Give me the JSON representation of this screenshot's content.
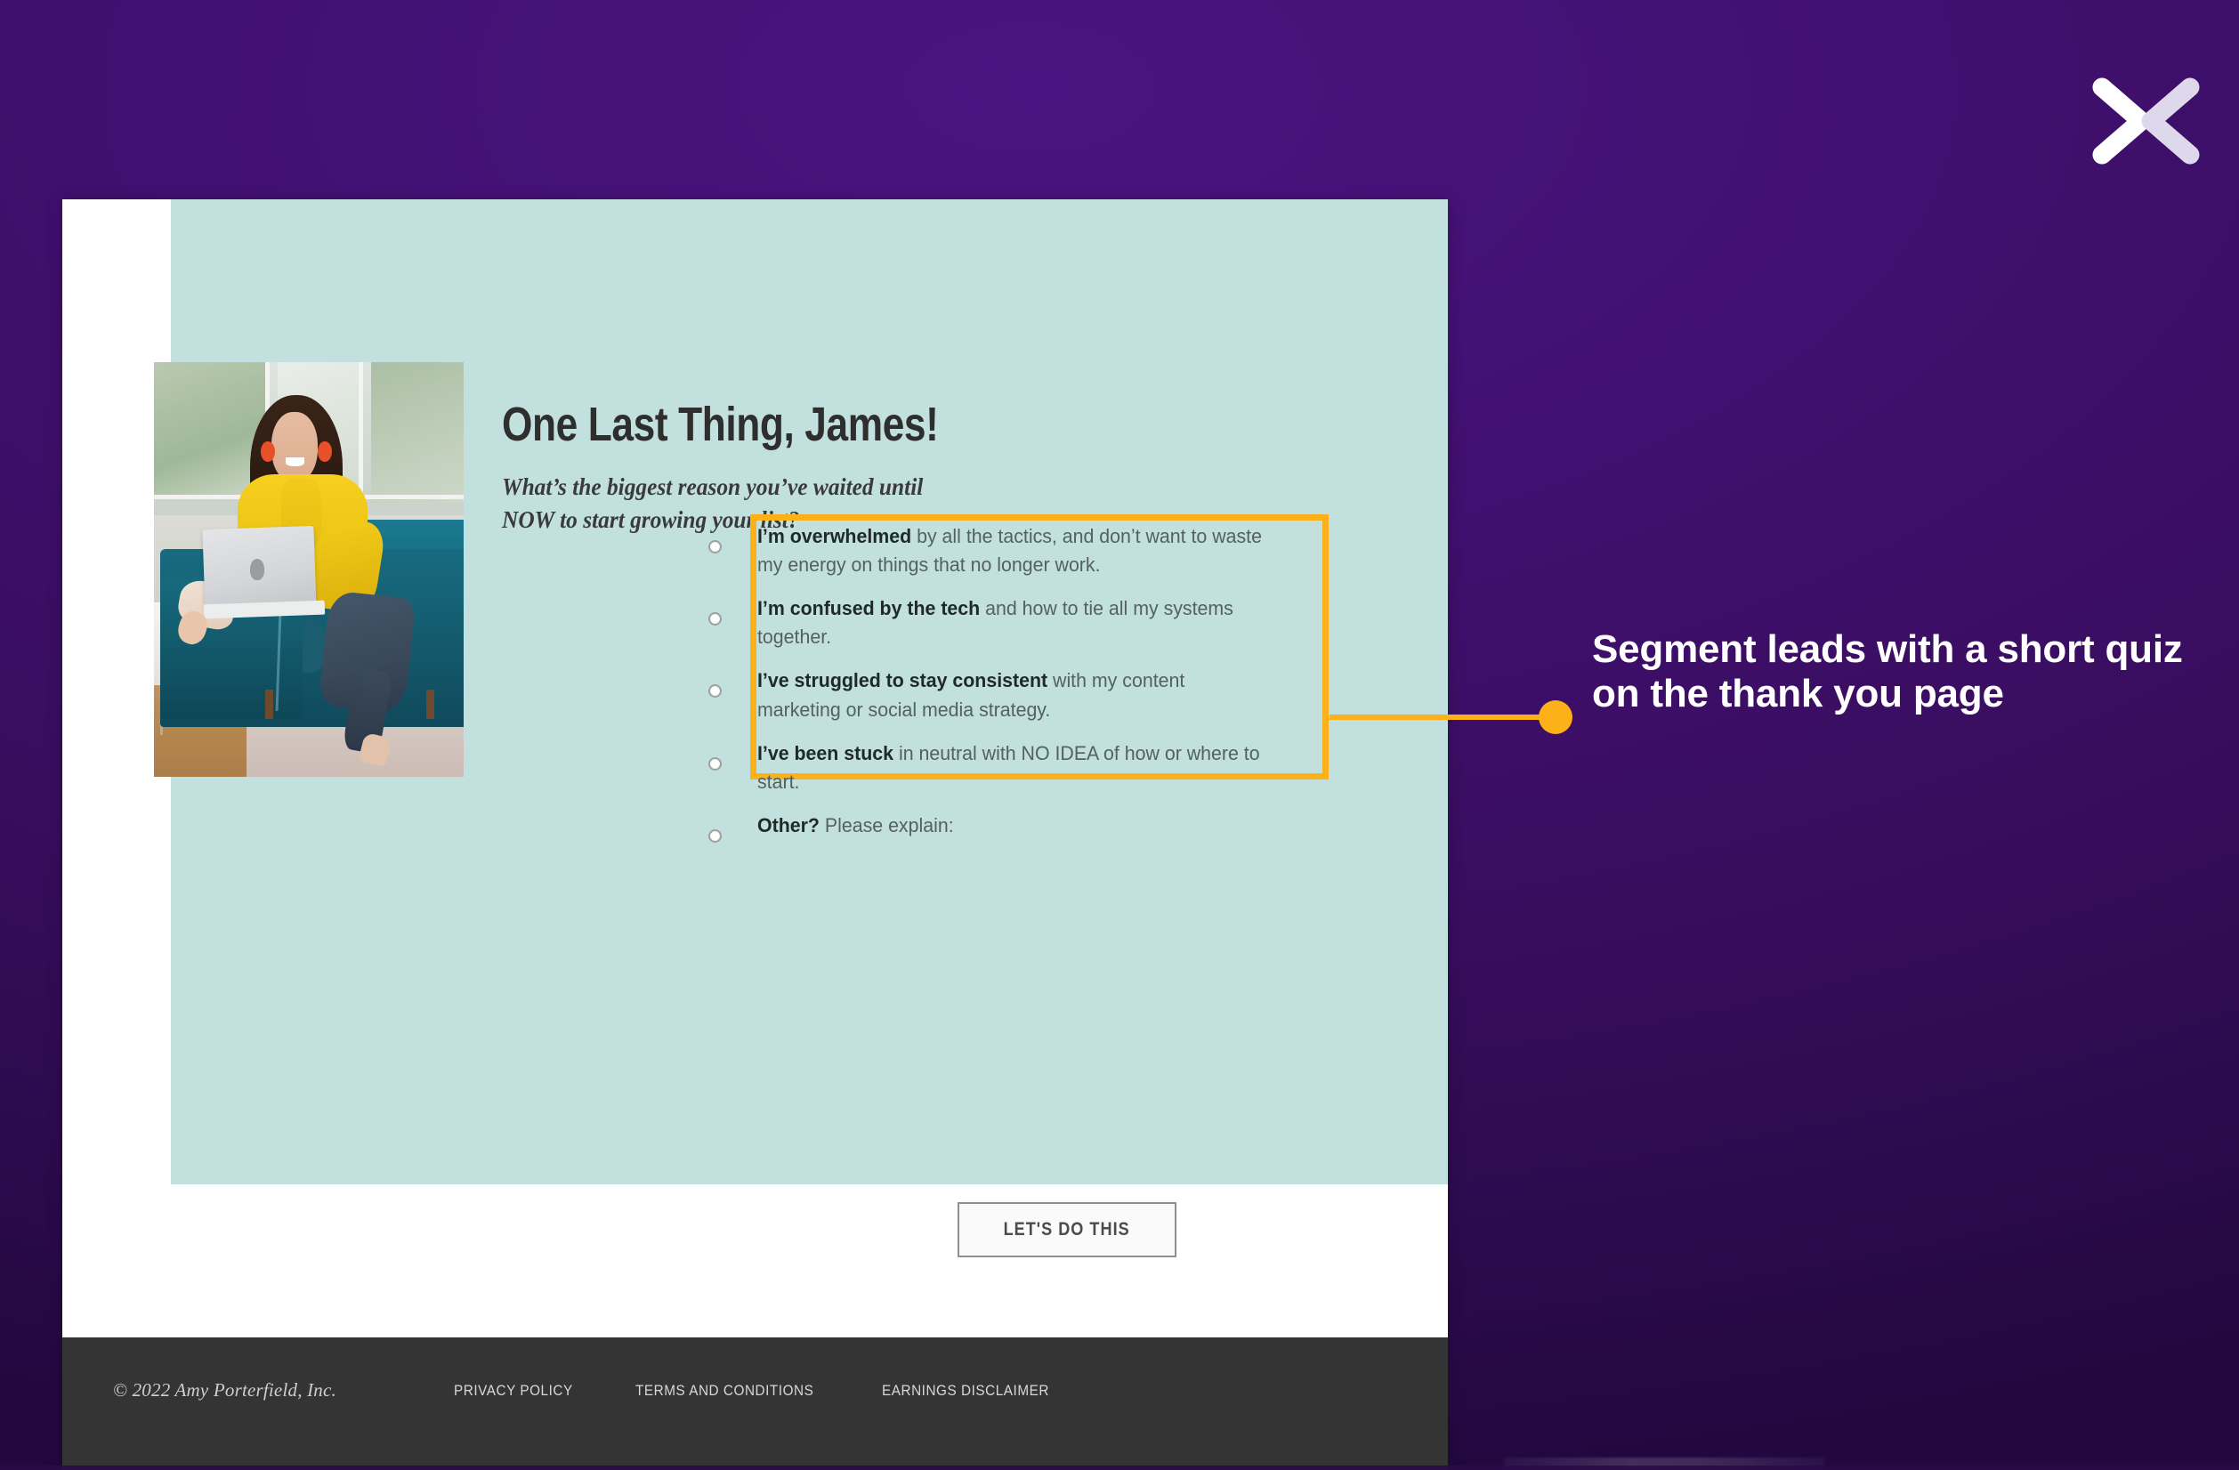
{
  "logo": {
    "icon": "x-chevrons-logo"
  },
  "annotation": {
    "text": "Segment leads with a short quiz on the thank you page",
    "accent_color": "#fbb117"
  },
  "screenshot": {
    "headline": "One Last Thing, James!",
    "subheadline": "What’s the biggest reason you’ve waited until NOW to start growing your list?",
    "photo_alt": "woman-on-teal-sofa-with-laptop",
    "quiz": {
      "highlight_color": "#fbb117",
      "options": [
        {
          "bold": "I’m overwhelmed",
          "rest": " by all the tactics, and don’t want to waste my energy on things that no longer work."
        },
        {
          "bold": "I’m confused by the tech",
          "rest": " and how to tie all my systems together."
        },
        {
          "bold": "I’ve struggled to stay consistent",
          "rest": " with my content marketing or social media strategy."
        },
        {
          "bold": "I’ve been stuck",
          "rest": " in neutral with NO IDEA of how or where to start."
        },
        {
          "bold": "Other?",
          "rest": " Please explain:"
        }
      ]
    },
    "cta_label": "LET'S DO THIS",
    "footer": {
      "copyright": "© 2022 Amy Porterfield, Inc.",
      "links": [
        "PRIVACY POLICY",
        "TERMS AND CONDITIONS",
        "EARNINGS DISCLAIMER"
      ]
    }
  },
  "colors": {
    "background_purple": "#42107 1",
    "mint": "#c2e0dd",
    "accent_yellow": "#fbb117",
    "footer_dark": "#343434"
  }
}
